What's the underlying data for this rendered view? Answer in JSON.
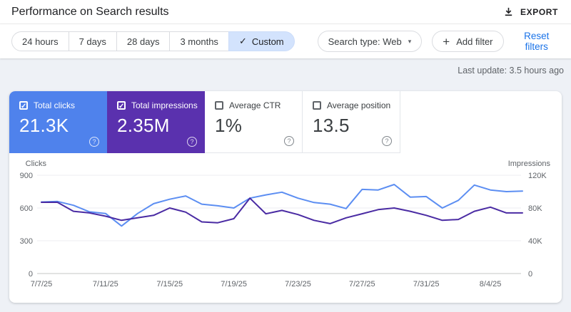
{
  "header": {
    "title": "Performance on Search results",
    "export_label": "EXPORT"
  },
  "filter_bar": {
    "date_ranges": [
      {
        "label": "24 hours",
        "selected": false
      },
      {
        "label": "7 days",
        "selected": false
      },
      {
        "label": "28 days",
        "selected": false
      },
      {
        "label": "3 months",
        "selected": false
      },
      {
        "label": "Custom",
        "selected": true
      }
    ],
    "search_type_label": "Search type: Web",
    "add_filter_label": "Add filter",
    "reset_filters_label": "Reset filters"
  },
  "status": {
    "last_update": "Last update: 3.5 hours ago"
  },
  "icons": {
    "check": "✓",
    "caret": "▾",
    "plus": "+",
    "help": "?"
  },
  "colors": {
    "accent_link": "#1a73e8",
    "clicks_tile": "#4f82ec",
    "impressions_tile": "#5a31ae",
    "clicks_line": "#5c8ef2",
    "impressions_line": "#4a2ba3",
    "selected_chip_bg": "#d3e3fd"
  },
  "metrics": [
    {
      "label": "Total clicks",
      "value": "21.3K",
      "checked": true,
      "bg": "#4f82ec"
    },
    {
      "label": "Total impressions",
      "value": "2.35M",
      "checked": true,
      "bg": "#5a31ae"
    },
    {
      "label": "Average CTR",
      "value": "1%",
      "checked": false,
      "bg": ""
    },
    {
      "label": "Average position",
      "value": "13.5",
      "checked": false,
      "bg": ""
    }
  ],
  "chart_data": {
    "type": "line",
    "x": [
      "7/7/25",
      "7/8/25",
      "7/9/25",
      "7/10/25",
      "7/11/25",
      "7/12/25",
      "7/13/25",
      "7/14/25",
      "7/15/25",
      "7/16/25",
      "7/17/25",
      "7/18/25",
      "7/19/25",
      "7/20/25",
      "7/21/25",
      "7/22/25",
      "7/23/25",
      "7/24/25",
      "7/25/25",
      "7/26/25",
      "7/27/25",
      "7/28/25",
      "7/29/25",
      "7/30/25",
      "7/31/25",
      "8/1/25",
      "8/2/25",
      "8/3/25",
      "8/4/25",
      "8/5/25",
      "8/6/25"
    ],
    "x_tick_indices": [
      0,
      4,
      8,
      12,
      16,
      20,
      24,
      28
    ],
    "series": [
      {
        "name": "Total clicks",
        "axis": "left",
        "color": "#5c8ef2",
        "values": [
          655,
          660,
          625,
          565,
          550,
          435,
          550,
          640,
          680,
          710,
          635,
          620,
          600,
          690,
          720,
          745,
          690,
          650,
          635,
          595,
          770,
          765,
          815,
          700,
          705,
          600,
          670,
          810,
          765,
          750,
          755
        ]
      },
      {
        "name": "Total impressions (thousands)",
        "axis": "right",
        "color": "#4a2ba3",
        "values": [
          87,
          87,
          76,
          74,
          70,
          65,
          68,
          71,
          80,
          75,
          63,
          62,
          67,
          92,
          73,
          77,
          72,
          65,
          61,
          68,
          73,
          78,
          80,
          76,
          71,
          65,
          66,
          76,
          81,
          74,
          74
        ]
      }
    ],
    "left_axis": {
      "label": "Clicks",
      "max": 900,
      "tick_values": [
        900,
        600,
        300,
        0
      ],
      "tick_labels": [
        "900",
        "600",
        "300",
        "0"
      ]
    },
    "right_axis": {
      "label": "Impressions",
      "max": 120,
      "tick_values": [
        120,
        80,
        40,
        0
      ],
      "tick_labels": [
        "120K",
        "80K",
        "40K",
        "0"
      ]
    },
    "grid": "horizontal",
    "legend": "none"
  }
}
